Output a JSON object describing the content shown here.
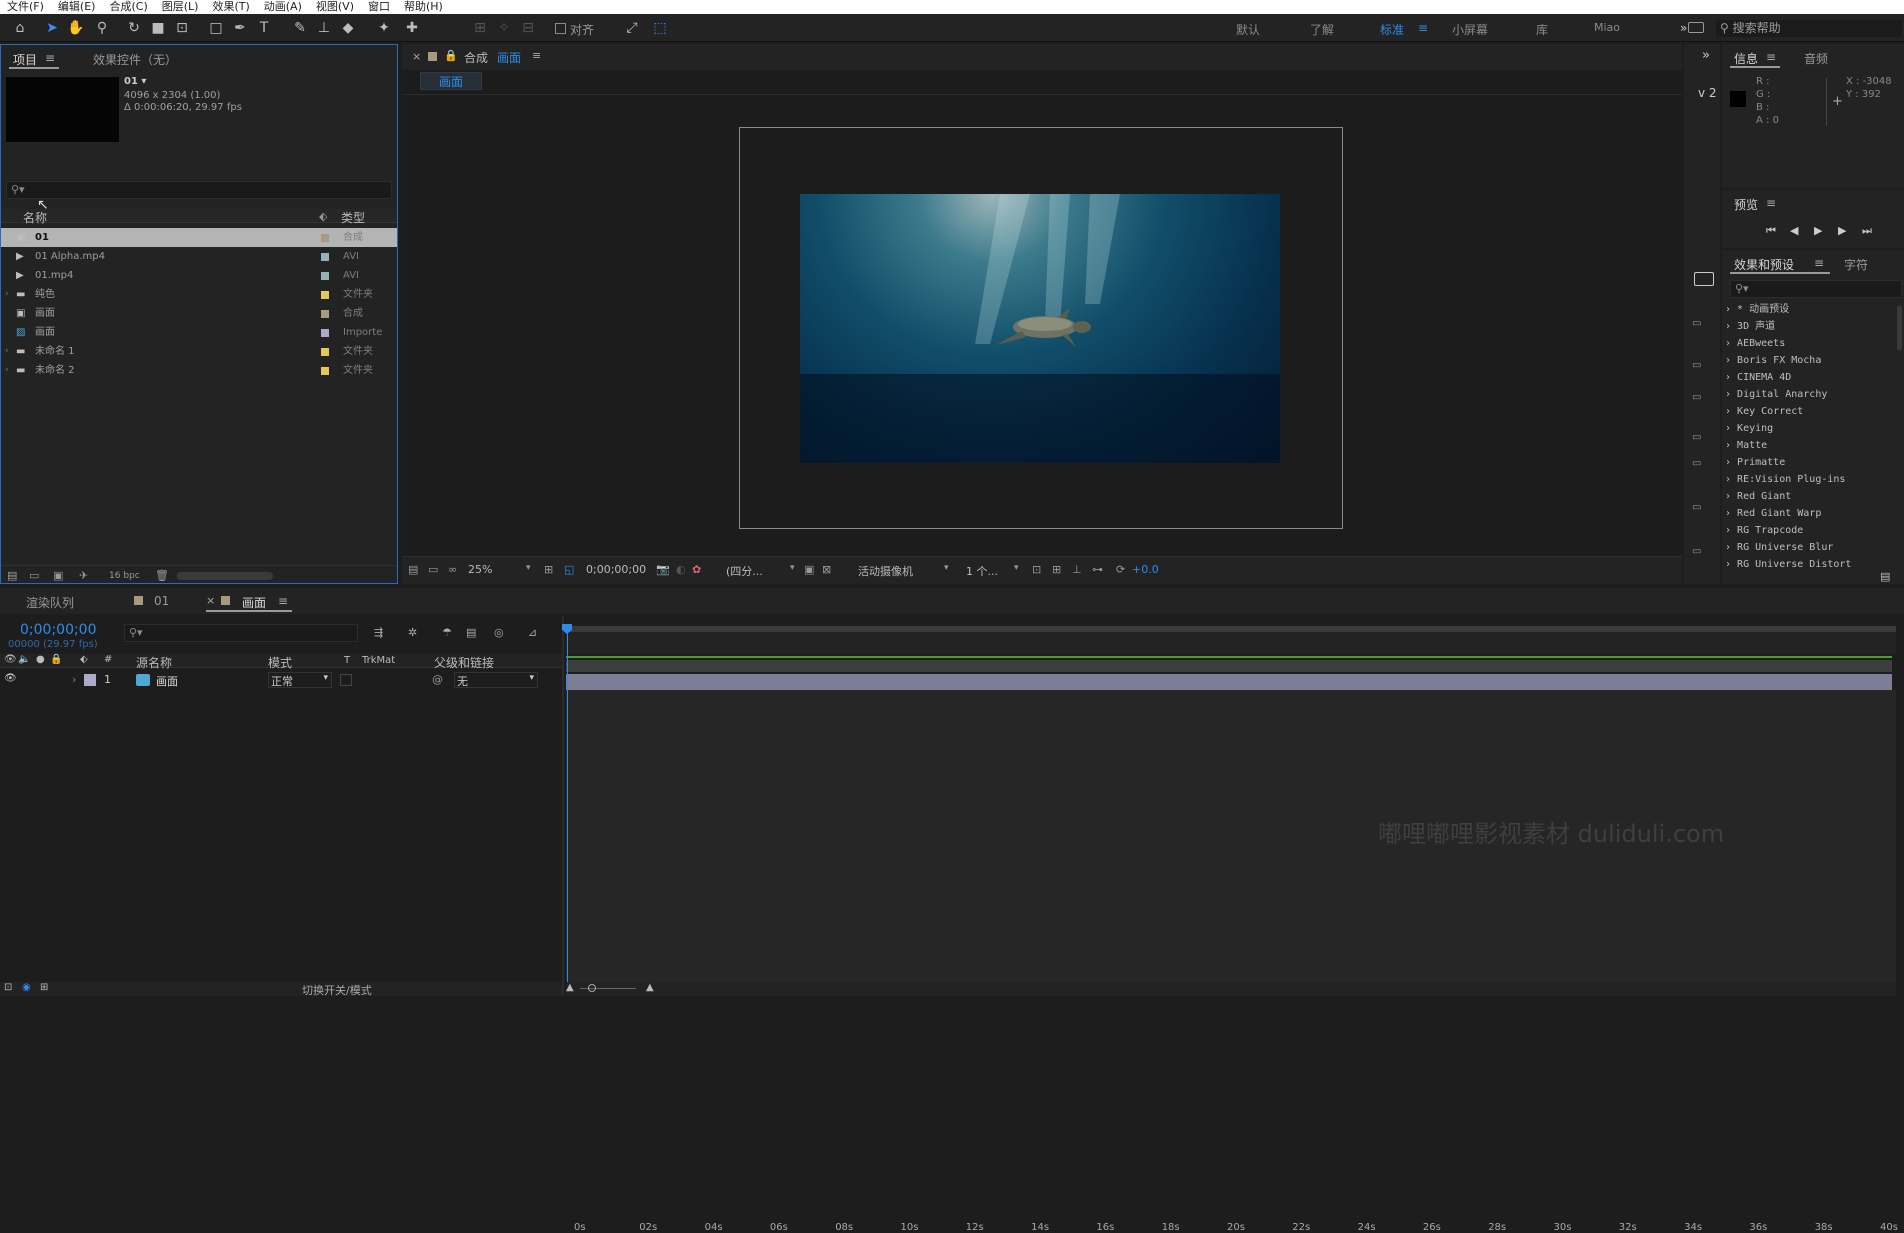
{
  "menu": [
    "文件(F)",
    "编辑(E)",
    "合成(C)",
    "图层(L)",
    "效果(T)",
    "动画(A)",
    "视图(V)",
    "窗口",
    "帮助(H)"
  ],
  "toolbar": {
    "align_label": "对齐",
    "workspaces": [
      "默认",
      "了解",
      "标准",
      "小屏幕",
      "库",
      "Miao"
    ],
    "active_workspace": "标准",
    "search_help_placeholder": "搜索帮助"
  },
  "project_panel": {
    "tab_project": "项目",
    "tab_effect_controls": "效果控件（无）",
    "selected_name": "01",
    "selected_dims": "4096 x 2304 (1.00)",
    "selected_duration": "Δ 0:00:06:20, 29.97 fps",
    "col_name": "名称",
    "col_type": "类型",
    "items": [
      {
        "name": "01",
        "type": "合成",
        "color": "#a89a7e",
        "icon": "composition-icon",
        "expand": ""
      },
      {
        "name": "01 Alpha.mp4",
        "type": "AVI",
        "color": "#8fb3b6",
        "icon": "video-file-icon",
        "expand": ""
      },
      {
        "name": "01.mp4",
        "type": "AVI",
        "color": "#8fb3b6",
        "icon": "video-file-icon",
        "expand": ""
      },
      {
        "name": "纯色",
        "type": "文件夹",
        "color": "#e3c85a",
        "icon": "folder-icon",
        "expand": "›"
      },
      {
        "name": "画面",
        "type": "合成",
        "color": "#a89a7e",
        "icon": "composition-icon",
        "expand": ""
      },
      {
        "name": "画面",
        "type": "Importe",
        "color": "#a9abc9",
        "icon": "image-file-icon",
        "expand": ""
      },
      {
        "name": "未命名 1",
        "type": "文件夹",
        "color": "#e3c85a",
        "icon": "folder-icon",
        "expand": "›"
      },
      {
        "name": "未命名 2",
        "type": "文件夹",
        "color": "#e3c85a",
        "icon": "folder-icon",
        "expand": "›"
      }
    ],
    "bpc": "16 bpc"
  },
  "composition_viewer": {
    "tab_prefix": "合成",
    "tab_name": "画面",
    "breadcrumb": "画面",
    "zoom": "25%",
    "timecode": "0;00;00;00",
    "resolution": "(四分...",
    "camera": "活动摄像机",
    "views": "1 个...",
    "exposure": "+0.0",
    "v_label": "v 2"
  },
  "info_panel": {
    "tab_info": "信息",
    "tab_audio": "音频",
    "r": "R :",
    "g": "G :",
    "b": "B :",
    "a": "A : 0",
    "x": "X : -3048",
    "y": "Y : 392"
  },
  "preview_panel": {
    "title": "预览"
  },
  "effects_panel": {
    "tab_effects": "效果和预设",
    "tab_char": "字符",
    "items": [
      "* 动画预设",
      "3D 声道",
      "AEBweets",
      "Boris FX Mocha",
      "CINEMA 4D",
      "Digital Anarchy",
      "Key Correct",
      "Keying",
      "Matte",
      "Primatte",
      "RE:Vision Plug-ins",
      "Red Giant",
      "Red Giant Warp",
      "RG Trapcode",
      "RG Universe Blur",
      "RG Universe Distort"
    ]
  },
  "timeline": {
    "tab_render": "渲染队列",
    "tab_01": "01",
    "tab_active": "画面",
    "timecode": "0;00;00;00",
    "frame_info": "00000 (29.97 fps)",
    "col_source": "源名称",
    "col_mode": "模式",
    "col_t": "T",
    "col_trkmat": "TrkMat",
    "col_parent": "父级和链接",
    "layer": {
      "num": "1",
      "name": "画面",
      "mode": "正常",
      "parent": "无"
    },
    "ruler": [
      "0s",
      "02s",
      "04s",
      "06s",
      "08s",
      "10s",
      "12s",
      "14s",
      "16s",
      "18s",
      "20s",
      "22s",
      "24s",
      "26s",
      "28s",
      "30s",
      "32s",
      "34s",
      "36s",
      "38s",
      "40s"
    ],
    "toggle_label": "切换开关/模式"
  },
  "watermark": "嘟哩嘟哩影视素材 duliduli.com",
  "colors": {
    "accent": "#2d8ceb",
    "label_lavender": "#a9abc9",
    "track_green": "#4a9e3a"
  }
}
